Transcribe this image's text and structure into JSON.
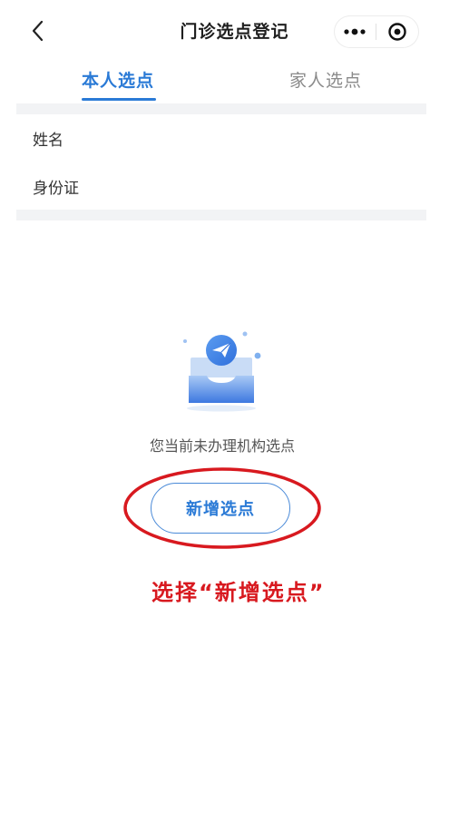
{
  "header": {
    "title": "门诊选点登记",
    "back_icon": "chevron-left-icon",
    "more_icon": "more-dots-icon",
    "close_icon": "target-circle-icon"
  },
  "tabs": [
    {
      "label": "本人选点",
      "active": true
    },
    {
      "label": "家人选点",
      "active": false
    }
  ],
  "info": {
    "name_label": "姓名",
    "id_label": "身份证"
  },
  "empty_state": {
    "icon": "inbox-paper-plane-icon",
    "message": "您当前未办理机构选点",
    "add_button_label": "新增选点"
  },
  "annotation": {
    "text": "选择“新增选点”",
    "color": "#d8191f"
  },
  "colors": {
    "accent": "#2a7ad6",
    "annotation_red": "#d8191f",
    "band_gray": "#f2f3f5"
  }
}
